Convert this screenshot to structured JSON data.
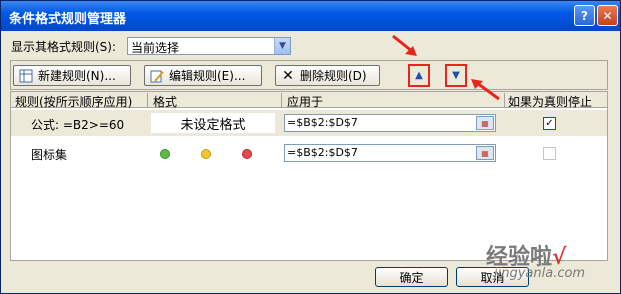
{
  "window": {
    "title": "条件格式规则管理器",
    "help": "?",
    "close": "✕"
  },
  "show_rules": {
    "label": "显示其格式规则(S):",
    "value": "当前选择"
  },
  "toolbar": {
    "new_rule": "新建规则(N)...",
    "edit_rule": "编辑规则(E)...",
    "delete_rule": "删除规则(D)",
    "move_up_icon": "move-up-icon",
    "move_down_icon": "move-down-icon"
  },
  "columns": {
    "rule": "规则(按所示顺序应用)",
    "format": "格式",
    "applies_to": "应用于",
    "stop_if_true": "如果为真则停止"
  },
  "rules": [
    {
      "name": "公式: =B2>=60",
      "format_preview": "未设定格式",
      "applies_to": "=$B$2:$D$7",
      "stop_if_true": true
    },
    {
      "name": "图标集",
      "icons": [
        "#5DBB4A",
        "#F2C72E",
        "#E34B4B"
      ],
      "applies_to": "=$B$2:$D$7",
      "stop_if_true": false
    }
  ],
  "footer": {
    "ok": "确定",
    "cancel": "取消"
  },
  "watermark": {
    "text": "经验啦",
    "check": "√",
    "url": "jingyanla.com"
  },
  "colors": {
    "highlight_red": "#E8251B",
    "titlebar_blue": "#0058E6"
  }
}
